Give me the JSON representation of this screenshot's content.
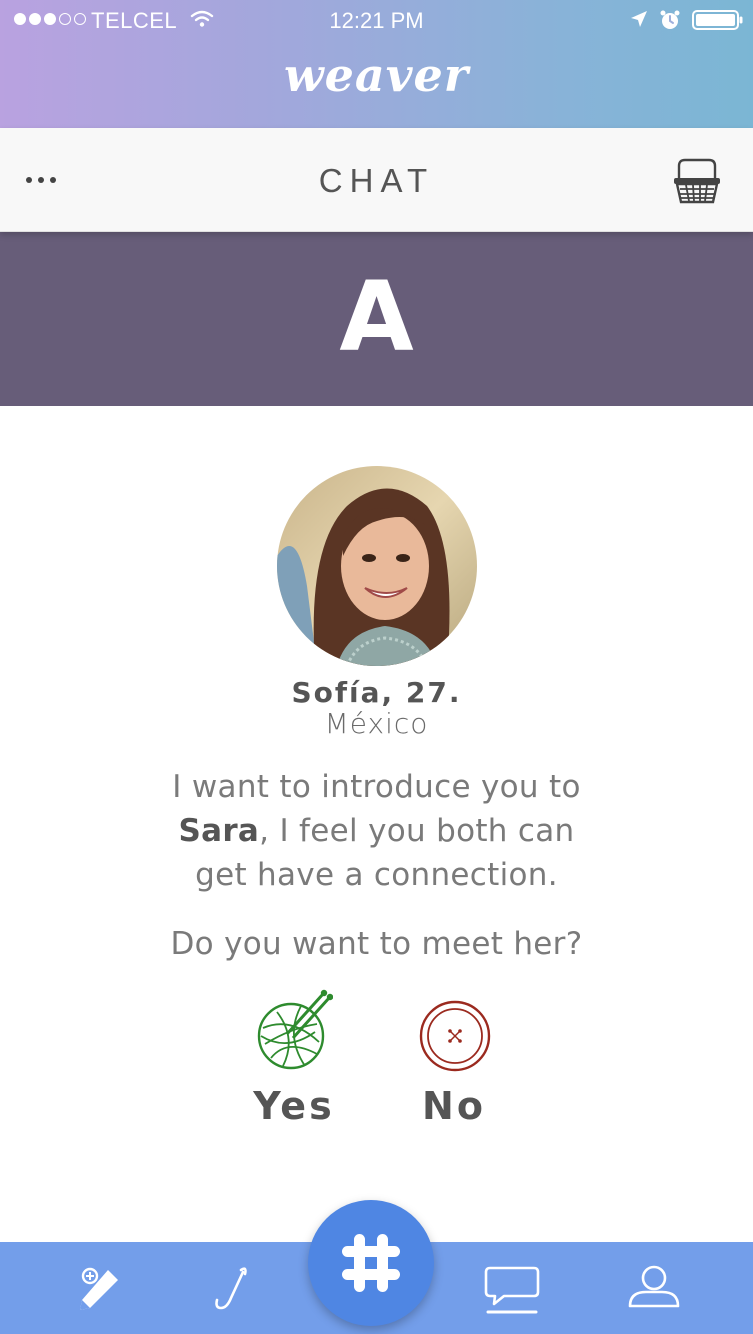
{
  "status_bar": {
    "carrier": "TELCEL",
    "time": "12:21 PM",
    "signal_bars_filled": 3,
    "signal_bars_total": 5
  },
  "app": {
    "brand": "weaver"
  },
  "nav": {
    "title": "CHAT",
    "left_icon": "more-dots-icon",
    "right_icon": "basket-icon"
  },
  "section": {
    "letter": "A",
    "color": "#675d79"
  },
  "profile": {
    "name": "Sofía, 27.",
    "location": "México",
    "intro_line1": "I want to introduce you to",
    "intro_name": "Sara",
    "intro_line2": ", I feel you both can",
    "intro_line3": "get have a connection.",
    "question": "Do you want to meet her?"
  },
  "answers": {
    "yes_label": "Yes",
    "no_label": "No",
    "yes_icon": "yarn-ball-icon",
    "no_icon": "button-icon",
    "yes_color": "#2e8b2e",
    "no_color": "#9b2a1f"
  },
  "tab_bar": {
    "items": [
      {
        "icon": "pencil-icon"
      },
      {
        "icon": "crochet-hook-icon"
      },
      {
        "icon": "slack-hash-icon"
      },
      {
        "icon": "chat-bubble-icon"
      },
      {
        "icon": "user-icon"
      }
    ],
    "color": "#739eea",
    "fab_color": "#4f86e3"
  },
  "colors": {
    "gradient_start": "#b9a2e0",
    "gradient_end": "#7bb6d4"
  }
}
